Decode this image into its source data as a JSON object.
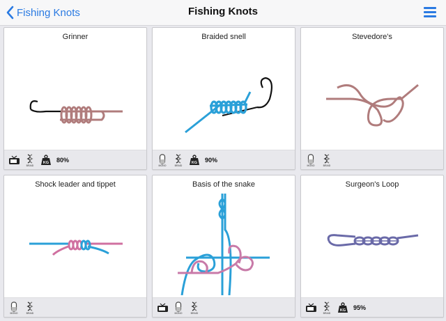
{
  "navbar": {
    "back_label": "Fishing Knots",
    "title": "Fishing Knots",
    "menu_icon": "hamburger-menu-icon",
    "accent_color": "#2a7ae2"
  },
  "knots": [
    {
      "name": "Grinner",
      "line_colors": [
        "#b07c7c"
      ],
      "icons": [
        "tv-icon",
        "braid-icon",
        "weight-icon"
      ],
      "strength": "80%"
    },
    {
      "name": "Braided snell",
      "line_colors": [
        "#2aa0d8"
      ],
      "icons": [
        "mono-icon",
        "braid-icon",
        "weight-icon"
      ],
      "strength": "90%"
    },
    {
      "name": "Stevedore's",
      "line_colors": [
        "#b07c7c"
      ],
      "icons": [
        "mono-icon",
        "braid-icon"
      ],
      "strength": ""
    },
    {
      "name": "Shock leader and tippet",
      "line_colors": [
        "#2aa0d8",
        "#d070a0"
      ],
      "icons": [
        "mono-icon",
        "braid-icon"
      ],
      "strength": ""
    },
    {
      "name": "Basis of the snake",
      "line_colors": [
        "#2aa0d8",
        "#c87aa8"
      ],
      "icons": [
        "tv-icon",
        "mono-icon",
        "braid-icon"
      ],
      "strength": ""
    },
    {
      "name": "Surgeon's Loop",
      "line_colors": [
        "#6a6aa8"
      ],
      "icons": [
        "tv-icon",
        "braid-icon",
        "weight-icon"
      ],
      "strength": "95%"
    }
  ],
  "icon_labels": {
    "mono": "MONO",
    "braid": "BRAID",
    "weight": "KG"
  }
}
